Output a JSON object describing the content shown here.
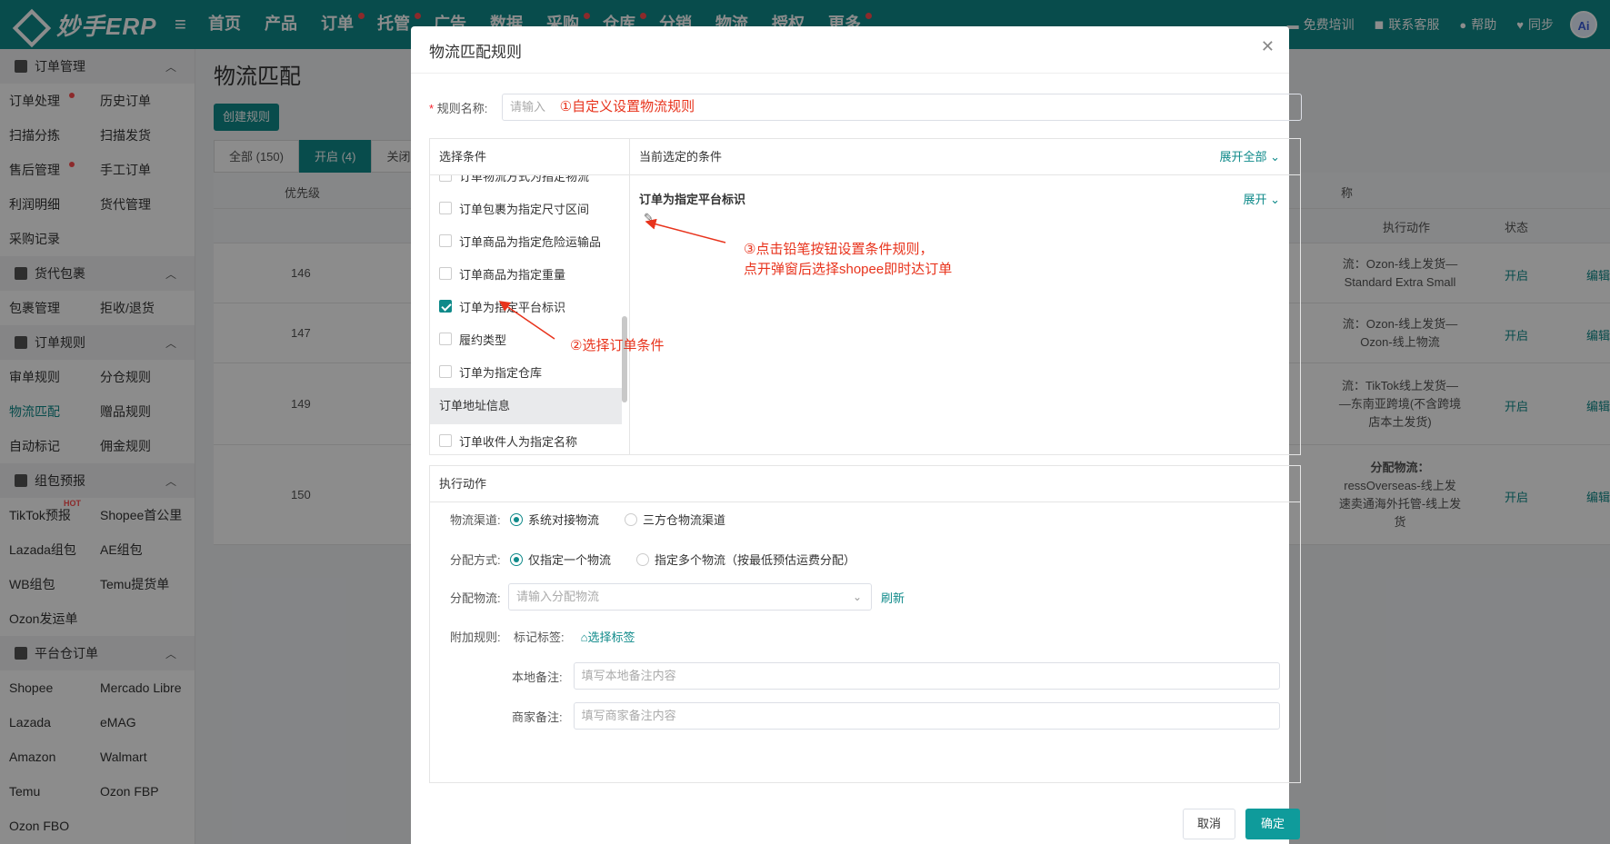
{
  "app": {
    "logo_text": "妙手ERP",
    "nav": [
      "首页",
      "产品",
      "订单",
      "托管",
      "广告",
      "数据",
      "采购",
      "仓库",
      "分销",
      "物流",
      "授权",
      "更多"
    ],
    "nav_dots": [
      false,
      false,
      true,
      true,
      false,
      false,
      true,
      true,
      false,
      false,
      false,
      true
    ],
    "right": [
      "免费培训",
      "联系客服",
      "帮助",
      "同步"
    ],
    "avatar": "Ai"
  },
  "sidebar": {
    "groups": [
      {
        "title": "订单管理",
        "links": [
          "订单处理",
          "历史订单",
          "扫描分拣",
          "扫描发货",
          "售后管理",
          "手工订单",
          "利润明细",
          "货代管理",
          "采购记录"
        ]
      },
      {
        "title": "货代包裹",
        "links": [
          "包裹管理",
          "拒收/退货"
        ]
      },
      {
        "title": "订单规则",
        "links": [
          "审单规则",
          "分仓规则",
          "物流匹配",
          "赠品规则",
          "自动标记",
          "佣金规则"
        ]
      },
      {
        "title": "组包预报",
        "links": [
          "TikTok预报",
          "Shopee首公里",
          "Lazada组包",
          "AE组包",
          "WB组包",
          "Temu提货单",
          "Ozon发运单"
        ]
      },
      {
        "title": "平台仓订单",
        "links": [
          "Shopee",
          "Mercado Libre",
          "Lazada",
          "eMAG",
          "Amazon",
          "Walmart",
          "Temu",
          "Ozon FBP",
          "Ozon FBO"
        ]
      }
    ],
    "hot_badge": "HOT"
  },
  "page": {
    "title": "物流匹配",
    "create_button": "创建规则",
    "tabs": [
      "全部 (150)",
      "开启 (4)",
      "关闭"
    ],
    "columns": {
      "priority": "优先级",
      "name_hint": "称",
      "action": "执行动作",
      "status": "状态"
    },
    "rows": [
      {
        "priority": "146",
        "action_lines": [
          "流：Ozon-线上发货—",
          "Standard Extra Small"
        ],
        "status": "开启",
        "edit": "编辑"
      },
      {
        "priority": "147",
        "action_lines": [
          "流：Ozon-线上发货—",
          "Ozon-线上物流"
        ],
        "status": "开启",
        "edit": "编辑"
      },
      {
        "priority": "149",
        "action_lines": [
          "流：TikTok线上发货—",
          "—东南亚跨境(不含跨境",
          "店本土发货)"
        ],
        "status": "开启",
        "edit": "编辑"
      },
      {
        "priority": "150",
        "action_lines": [
          "分配物流：",
          "ressOverseas-线上发",
          "速卖通海外托管-线上发",
          "货"
        ],
        "status": "开启",
        "edit": "编辑"
      }
    ]
  },
  "modal": {
    "title": "物流匹配规则",
    "name_label": "规则名称:",
    "name_placeholder": "请输入",
    "annotation_1": "①自定义设置物流规则",
    "select_head": "选择条件",
    "conditions": [
      {
        "label": "订单物流方式为指定物流",
        "checked": false
      },
      {
        "label": "订单包裹为指定尺寸区间",
        "checked": false
      },
      {
        "label": "订单商品为指定危险运输品",
        "checked": false
      },
      {
        "label": "订单商品为指定重量",
        "checked": false
      },
      {
        "label": "订单为指定平台标识",
        "checked": true
      },
      {
        "label": "履约类型",
        "checked": false
      },
      {
        "label": "订单为指定仓库",
        "checked": false
      }
    ],
    "section_label": "订单地址信息",
    "after_section": [
      {
        "label": "订单收件人为指定名称",
        "checked": false
      }
    ],
    "current_head": "当前选定的条件",
    "expand_all": "展开全部",
    "selected_title": "订单为指定平台标识",
    "selected_expand": "展开",
    "annotation_2": "②选择订单条件",
    "annotation_3": [
      "③点击铅笔按钮设置条件规则，",
      "点开弹窗后选择shopee即时达订单"
    ],
    "action_head": "执行动作",
    "channel_label": "物流渠道:",
    "channel_options": [
      "系统对接物流",
      "三方仓物流渠道"
    ],
    "assign_label": "分配方式:",
    "assign_options": [
      "仅指定一个物流",
      "指定多个物流（按最低预估运费分配）"
    ],
    "logistics_label": "分配物流:",
    "logistics_placeholder": "请输入分配物流",
    "refresh": "刷新",
    "extra_label": "附加规则:",
    "tag_label": "标记标签:",
    "tag_link": "选择标签",
    "local_label": "本地备注:",
    "local_placeholder": "填写本地备注内容",
    "merchant_label": "商家备注:",
    "merchant_placeholder": "填写商家备注内容",
    "cancel": "取消",
    "ok": "确定"
  },
  "colors": {
    "brand": "#0f8a8a",
    "annotation": "#e8331c",
    "dot": "#ff4d4f"
  }
}
